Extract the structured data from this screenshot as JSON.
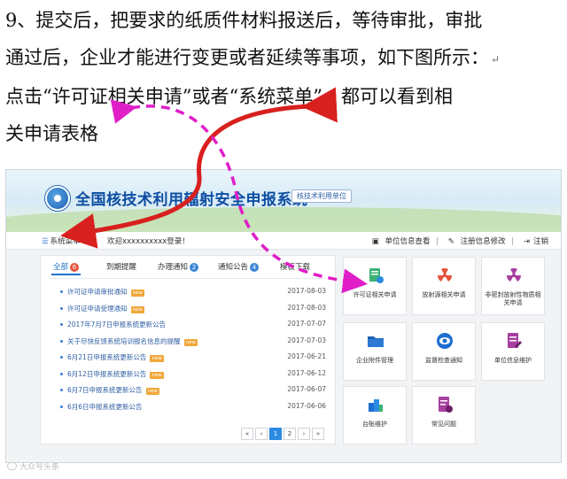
{
  "doc": {
    "lines": [
      "9、提交后，把要求的纸质件材料报送后，等待审批，审批",
      "通过后，企业才能进行变更或者延续等事项，如下图所示：",
      "点击“许可证相关申请”或者“系统菜单”，都可以看到相",
      "关申请表格"
    ],
    "para_mark": "↵"
  },
  "app": {
    "title": "全国核技术利用辐射安全申报系统",
    "unit_badge": "核技术利用单位",
    "menu_label": "系统菜单",
    "welcome": "欢迎xxxxxxxxxx登录！",
    "link_unit_info": "单位信息查看",
    "link_reg_change": "注册信息修改",
    "link_logout": "注销",
    "tabs": [
      {
        "label": "全部",
        "count": "6"
      },
      {
        "label": "到期提醒",
        "count": ""
      },
      {
        "label": "办理通知",
        "count": "2"
      },
      {
        "label": "通知公告",
        "count": "4"
      },
      {
        "label": "模板下载",
        "count": ""
      }
    ],
    "new_badge": "new",
    "news": [
      {
        "title": "许可证申请审批通知",
        "date": "2017-08-03",
        "is_new": true
      },
      {
        "title": "许可证申请受理通知",
        "date": "2017-08-03",
        "is_new": true
      },
      {
        "title": "2017年7月7日申报系统更新公告",
        "date": "2017-07-07",
        "is_new": false
      },
      {
        "title": "关于尽快反馈系统培训报名信息的提醒",
        "date": "2017-07-03",
        "is_new": true
      },
      {
        "title": "6月21日申报系统更新公告",
        "date": "2017-06-21",
        "is_new": true
      },
      {
        "title": "6月12日申报系统更新公告",
        "date": "2017-06-12",
        "is_new": true
      },
      {
        "title": "6月7日申报系统更新公告",
        "date": "2017-06-07",
        "is_new": true
      },
      {
        "title": "6月6日申报系统更新公告",
        "date": "2017-06-06",
        "is_new": false
      }
    ],
    "pager": [
      "«",
      "‹",
      "1",
      "2",
      "›",
      "»"
    ],
    "tiles": [
      {
        "label": "许可证相关申请",
        "icon": "certificate-icon",
        "color": "#3bb273"
      },
      {
        "label": "放射源相关申请",
        "icon": "radiation-icon",
        "color": "#e5533c"
      },
      {
        "label": "非密封放射性物质相关申请",
        "icon": "radiation-icon",
        "color": "#a63fa0"
      },
      {
        "label": "企业附件管理",
        "icon": "folder-icon",
        "color": "#1c5fb3"
      },
      {
        "label": "监督检查通知",
        "icon": "eye-icon",
        "color": "#1c6fd1"
      },
      {
        "label": "单位信息维护",
        "icon": "document-edit-icon",
        "color": "#a63fa0"
      },
      {
        "label": "台账维护",
        "icon": "ledger-icon",
        "color": "#1c6fd1"
      },
      {
        "label": "常见问题",
        "icon": "help-document-icon",
        "color": "#a63fa0"
      }
    ]
  },
  "colors": {
    "arrow_red": "#d8201e",
    "arrow_magenta": "#e01ec8",
    "brand_blue": "#0d4da1"
  },
  "watermark": "大众号头条"
}
